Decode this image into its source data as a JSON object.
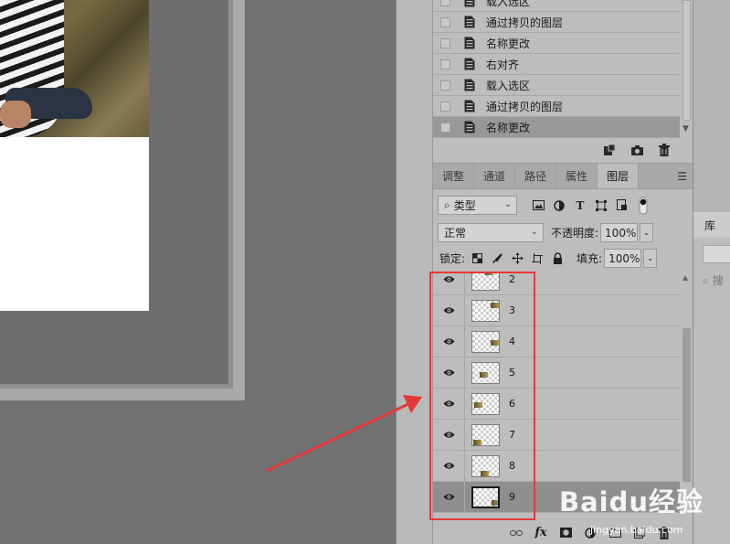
{
  "history": {
    "items": [
      {
        "label": "载入选区"
      },
      {
        "label": "通过拷贝的图层"
      },
      {
        "label": "名称更改"
      },
      {
        "label": "右对齐"
      },
      {
        "label": "载入选区"
      },
      {
        "label": "通过拷贝的图层"
      },
      {
        "label": "名称更改",
        "selected": true
      }
    ],
    "footer_icons": [
      "new-document-from-state-icon",
      "camera-snapshot-icon",
      "trash-icon"
    ]
  },
  "layers_panel": {
    "tabs": [
      {
        "label": "调整"
      },
      {
        "label": "通道"
      },
      {
        "label": "路径"
      },
      {
        "label": "属性"
      },
      {
        "label": "图层",
        "active": true
      }
    ],
    "filter": {
      "label": "类型"
    },
    "filter_icons": [
      "image-filter-icon",
      "adjustment-filter-icon",
      "type-filter-icon",
      "shape-filter-icon",
      "smart-object-filter-icon",
      "filter-toggle-icon"
    ],
    "blend_mode": "正常",
    "opacity_label": "不透明度:",
    "opacity_value": "100%",
    "lock_label": "锁定:",
    "lock_icons": [
      "lock-transparent-icon",
      "lock-paint-icon",
      "lock-position-icon",
      "lock-artboard-icon",
      "lock-all-icon"
    ],
    "fill_label": "填充:",
    "fill_value": "100%",
    "layers": [
      {
        "name": "2"
      },
      {
        "name": "3"
      },
      {
        "name": "4"
      },
      {
        "name": "5"
      },
      {
        "name": "6"
      },
      {
        "name": "7"
      },
      {
        "name": "8"
      },
      {
        "name": "9",
        "selected": true
      }
    ],
    "footer_icons": [
      "link-layers-icon",
      "fx-icon",
      "add-mask-icon",
      "adjustment-layer-icon",
      "new-group-icon",
      "new-layer-icon",
      "delete-layer-icon"
    ],
    "fx_label": "fx"
  },
  "library_panel": {
    "tab_label": "库",
    "search_placeholder": "搜"
  },
  "watermark": {
    "brand": "Baidu经验",
    "url": "jingyan.baidu.com"
  },
  "colors": {
    "annotation_red": "#e23a3a",
    "panel_bg": "#bdbdbd",
    "canvas_bg": "#727272"
  }
}
